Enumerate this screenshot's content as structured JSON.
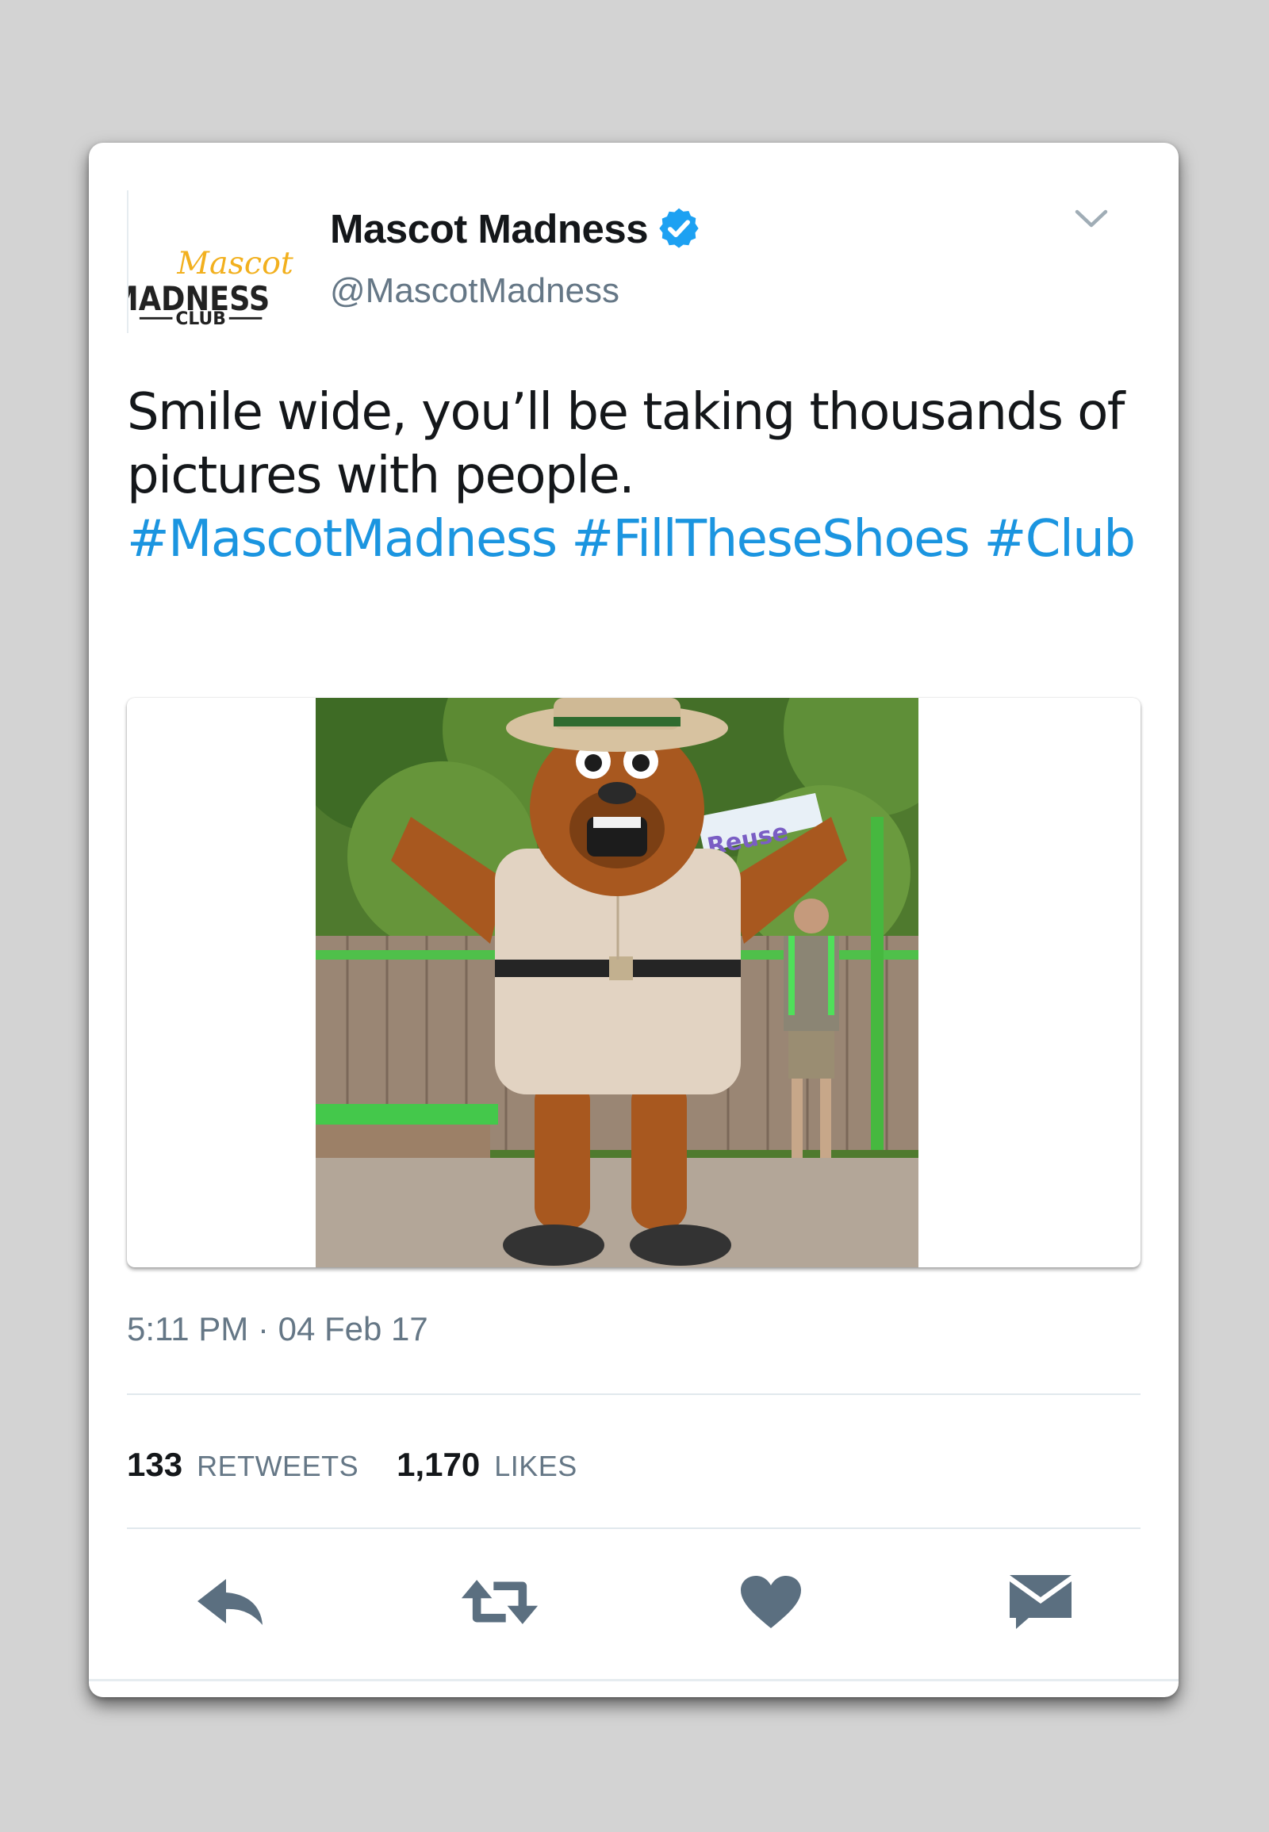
{
  "account": {
    "name": "Mascot Madness",
    "handle": "@MascotMadness",
    "verified": true,
    "avatar_logo": {
      "script_word": "Mascot",
      "main_word": "MADNESS",
      "sub_word": "CLUB"
    }
  },
  "tweet": {
    "text_line_1": "Smile wide, you’ll be taking thousands of",
    "text_line_2": "pictures with people.",
    "hashtags": [
      "#MascotMadness",
      "#FillTheseShoes",
      "#Club"
    ],
    "timestamp": "5:11 PM · 04 Feb 17",
    "media": {
      "banner_text": "Reuse"
    }
  },
  "stats": {
    "retweets_count": "133",
    "retweets_label": "RETWEETS",
    "likes_count": "1,170",
    "likes_label": "LIKES"
  },
  "actions": {
    "icons": [
      "reply-icon",
      "retweet-icon",
      "like-icon",
      "direct-message-icon"
    ]
  },
  "colors": {
    "background": "#d3d3d3",
    "card": "#ffffff",
    "link": "#1b95e0",
    "secondary_text": "#657786",
    "action_icon": "#5b6f80",
    "verified_badge": "#1da1f2",
    "logo_accent": "#f2b01e"
  }
}
